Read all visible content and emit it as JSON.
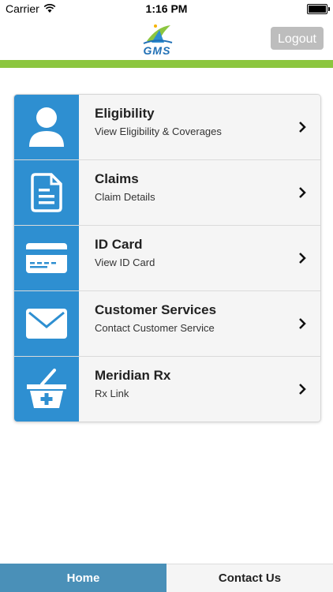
{
  "status_bar": {
    "carrier": "Carrier",
    "time": "1:16 PM"
  },
  "header": {
    "logo_text": "GMS",
    "logout_label": "Logout"
  },
  "colors": {
    "accent_green": "#8cc63f",
    "icon_blue": "#2e8fd1",
    "tab_active": "#4a90b8"
  },
  "menu": {
    "items": [
      {
        "title": "Eligibility",
        "subtitle": "View Eligibility & Coverages",
        "icon": "person-icon"
      },
      {
        "title": "Claims",
        "subtitle": "Claim Details",
        "icon": "document-icon"
      },
      {
        "title": "ID Card",
        "subtitle": "View ID Card",
        "icon": "id-card-icon"
      },
      {
        "title": "Customer Services",
        "subtitle": "Contact Customer Service",
        "icon": "envelope-icon"
      },
      {
        "title": "Meridian Rx",
        "subtitle": "Rx Link",
        "icon": "medical-basket-icon"
      }
    ]
  },
  "tabs": [
    {
      "label": "Home",
      "active": true
    },
    {
      "label": "Contact Us",
      "active": false
    }
  ]
}
